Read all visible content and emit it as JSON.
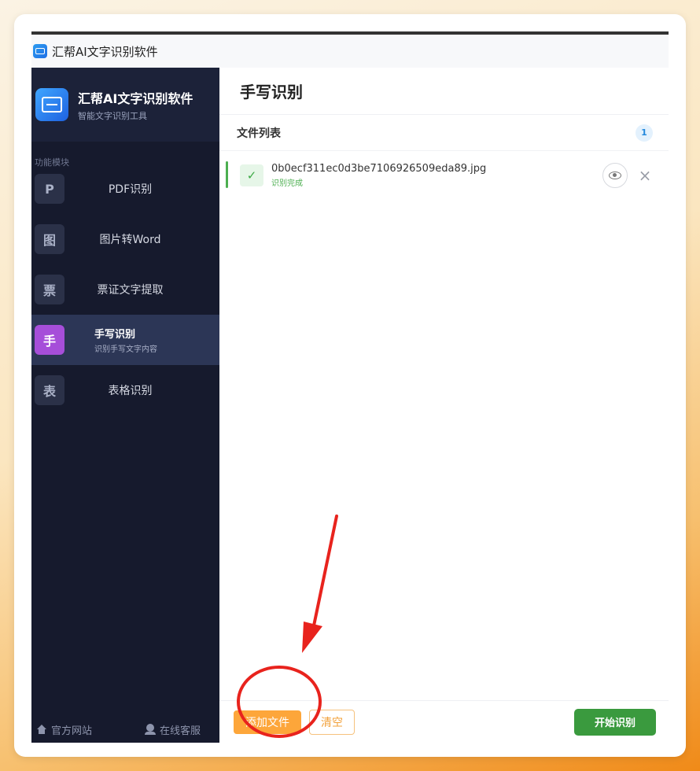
{
  "window": {
    "title": "汇帮AI文字识别软件"
  },
  "brand": {
    "title": "汇帮AI文字识别软件",
    "subtitle": "智能文字识别工具"
  },
  "sidebar": {
    "section_label": "功能模块",
    "items": [
      {
        "badge": "P",
        "label": "PDF识别"
      },
      {
        "badge": "图",
        "label": "图片转Word"
      },
      {
        "badge": "票",
        "label": "票证文字提取"
      },
      {
        "badge": "手",
        "label": "手写识别",
        "sub": "识别手写文字内容",
        "active": true
      },
      {
        "badge": "表",
        "label": "表格识别"
      }
    ],
    "footer": {
      "website": "官方网站",
      "support": "在线客服"
    }
  },
  "main": {
    "title": "手写识别",
    "list_label": "文件列表",
    "count": "1",
    "files": [
      {
        "name": "0b0ecf311ec0d3be7106926509eda89.jpg",
        "status": "识别完成"
      }
    ]
  },
  "buttons": {
    "add": "添加文件",
    "clear": "清空",
    "start": "开始识别"
  },
  "colors": {
    "accent_orange": "#fda63a",
    "start_green": "#3a9a3e",
    "sidebar_bg": "#161a2d",
    "active_purple": "#a64ed9",
    "annotation_red": "#e8231d"
  },
  "icons": [
    "app-icon",
    "check-icon",
    "eye-icon",
    "close-icon",
    "home-icon",
    "headset-icon"
  ]
}
